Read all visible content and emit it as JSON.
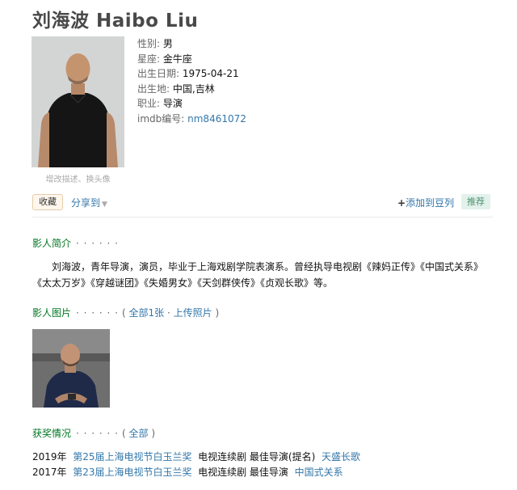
{
  "page_title": "刘海波 Haibo Liu",
  "photo": {
    "edit_link": "增改描述、换头像"
  },
  "info": [
    {
      "label": "性别:",
      "value": "男",
      "is_link": false
    },
    {
      "label": "星座:",
      "value": "金牛座",
      "is_link": false
    },
    {
      "label": "出生日期:",
      "value": "1975-04-21",
      "is_link": false
    },
    {
      "label": "出生地:",
      "value": "中国,吉林",
      "is_link": false
    },
    {
      "label": "职业:",
      "value": "导演",
      "is_link": false
    },
    {
      "label": "imdb编号:",
      "value": "nm8461072",
      "is_link": true
    }
  ],
  "actions": {
    "collect": "收藏",
    "share": "分享到",
    "share_caret": "▼",
    "add_plus": "+",
    "add_doulist": "添加到豆列",
    "recommend": "推荐"
  },
  "bio_section": {
    "title": "影人简介",
    "dots": "· · · · · ·",
    "text": "刘海波，青年导演，演员，毕业于上海戏剧学院表演系。曾经执导电视剧《辣妈正传》《中国式关系》《太太万岁》《穿越谜团》《失婚男女》《天剑群侠传》《贞观长歌》等。"
  },
  "photos_section": {
    "title": "影人图片",
    "dots": "· · · · · ·",
    "open": "(",
    "all": "全部1张",
    "sep": "·",
    "upload": "上传照片",
    "close": ")"
  },
  "awards_section": {
    "title": "获奖情况",
    "dots": "· · · · · ·",
    "open": "(",
    "all": "全部",
    "close": ")",
    "items": [
      {
        "year": "2019年",
        "award": "第25届上海电视节白玉兰奖",
        "category": "电视连续剧 最佳导演(提名)",
        "work": "天盛长歌"
      },
      {
        "year": "2017年",
        "award": "第23届上海电视节白玉兰奖",
        "category": "电视连续剧 最佳导演",
        "work": "中国式关系"
      }
    ]
  },
  "colors": {
    "section_title": "#007722",
    "link": "#3377aa",
    "collect_bg": "#fff7ed",
    "recommend_bg": "#e3f1ed",
    "recommend_text": "#4f946e"
  }
}
